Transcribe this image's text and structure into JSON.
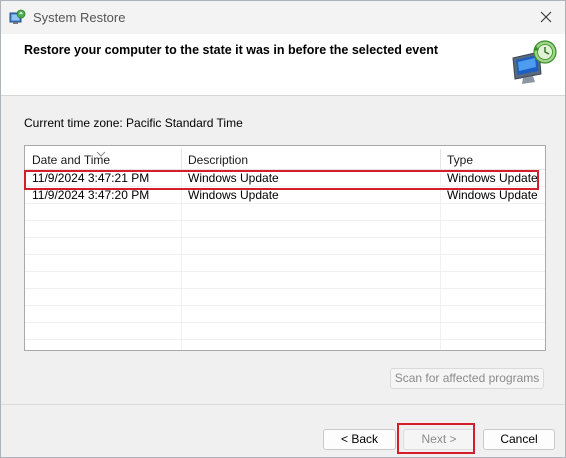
{
  "window": {
    "title": "System Restore",
    "header_title": "Restore your computer to the state it was in before the selected event"
  },
  "timezone": {
    "text": "Current time zone: Pacific Standard Time"
  },
  "table": {
    "columns": [
      "Date and Time",
      "Description",
      "Type"
    ],
    "sort_column": "Date and Time",
    "rows": [
      {
        "date": "11/9/2024 3:47:21 PM",
        "description": "Windows Update",
        "type": "Windows Update",
        "highlighted": true
      },
      {
        "date": "11/9/2024 3:47:20 PM",
        "description": "Windows Update",
        "type": "Windows Update",
        "highlighted": false
      }
    ]
  },
  "buttons": {
    "scan": "Scan for affected programs",
    "back": "< Back",
    "next": "Next >",
    "cancel": "Cancel"
  },
  "icons": {
    "app": "system-restore-icon",
    "close": "close-icon",
    "header": "restore-monitor-icon"
  },
  "colors": {
    "highlight_frame": "#d21f2b"
  }
}
